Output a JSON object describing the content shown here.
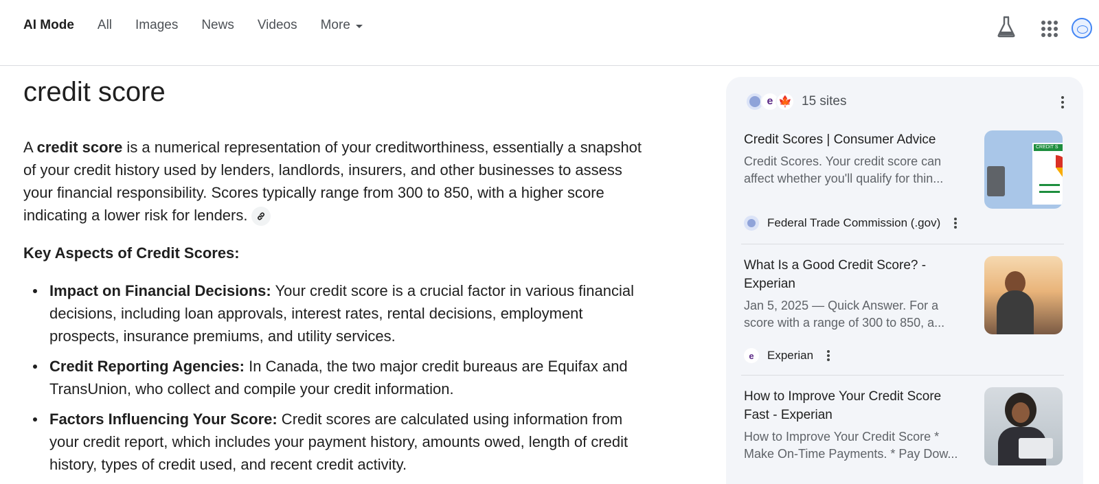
{
  "nav": {
    "tabs": [
      "AI Mode",
      "All",
      "Images",
      "News",
      "Videos",
      "More"
    ]
  },
  "main": {
    "query": "credit score",
    "answer": {
      "pre": "A ",
      "bold": "credit score",
      "post": " is a numerical representation of your creditworthiness, essentially a snapshot of your credit history used by lenders, landlords, insurers, and other businesses to assess your financial responsibility. Scores typically range from 300 to 850, with a higher score indicating a lower risk for lenders."
    },
    "subheading": "Key Aspects of Credit Scores:",
    "bullets": [
      {
        "label": "Impact on Financial Decisions:",
        "text": " Your credit score is a crucial factor in various financial decisions, including loan approvals, interest rates, rental decisions, employment prospects, insurance premiums, and utility services."
      },
      {
        "label": "Credit Reporting Agencies:",
        "text": " In Canada, the two major credit bureaus are Equifax and TransUnion, who collect and compile your credit information."
      },
      {
        "label": "Factors Influencing Your Score:",
        "text": " Credit scores are calculated using information from your credit report, which includes your payment history, amounts owed, length of credit history, types of credit used, and recent credit activity."
      }
    ]
  },
  "sources": {
    "count_label": "15 sites",
    "items": [
      {
        "title": "Credit Scores | Consumer Advice",
        "snippet": "Credit Scores. Your credit score can affect whether you'll qualify for thin...",
        "source": "Federal Trade Commission (.gov)",
        "thumb_badge": "CREDIT S"
      },
      {
        "title": "What Is a Good Credit Score? - Experian",
        "snippet": "Jan 5, 2025 — Quick Answer. For a score with a range of 300 to 850, a...",
        "source": "Experian"
      },
      {
        "title": "How to Improve Your Credit Score Fast - Experian",
        "snippet": "How to Improve Your Credit Score * Make On-Time Payments. * Pay Dow..."
      }
    ]
  },
  "icons": {
    "labs": "flask-icon",
    "apps": "apps-grid-icon",
    "account": "avatar",
    "link": "link-icon",
    "more": "more-vert-icon"
  },
  "colors": {
    "panel_bg": "#f3f5f9",
    "text": "#1f1f1f",
    "muted": "#5f6368",
    "accent_blue": "#4285f4"
  }
}
